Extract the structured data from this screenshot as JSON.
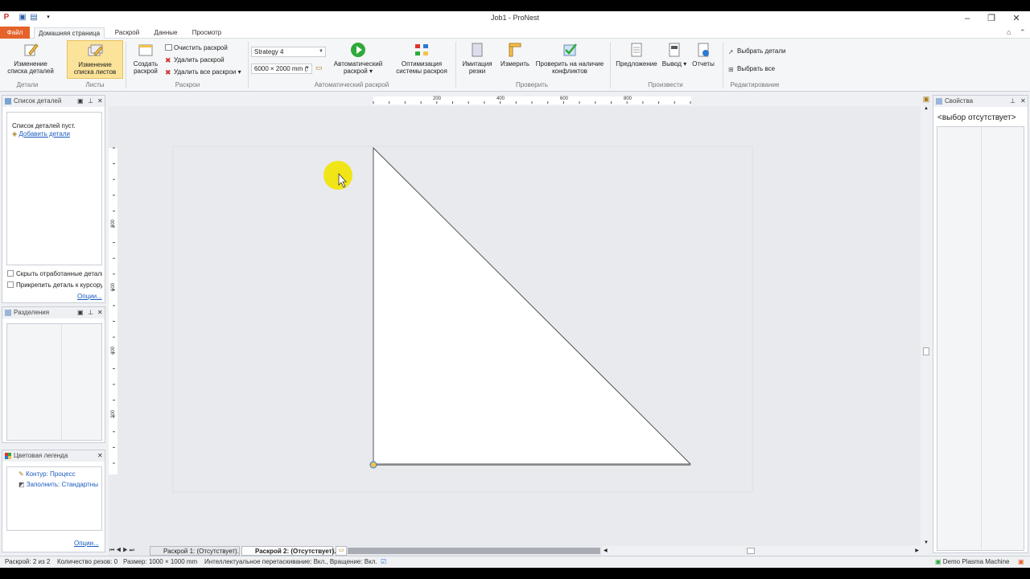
{
  "window": {
    "title": "Job1 - ProNest"
  },
  "ribbon_tabs": {
    "file": "Файл",
    "items": [
      "Домашняя страница",
      "Раскрой",
      "Данные",
      "Просмотр"
    ]
  },
  "ribbon": {
    "details": {
      "btn": "Изменение списка деталей",
      "group": "Детали"
    },
    "sheets": {
      "btn": "Изменение списка листов",
      "group": "Листы"
    },
    "nests": {
      "create": "Создать раскрой",
      "clear": "Очистить раскрой",
      "delete": "Удалить раскрой",
      "delete_all": "Удалить все раскрои",
      "group": "Раскрои"
    },
    "auto": {
      "strategy": "Strategy 4",
      "sheet_size": "6000 × 2000 mm (.",
      "btn": "Автоматический раскрой",
      "optimize": "Оптимизация системы раскроя",
      "group": "Автоматический раскрой"
    },
    "check": {
      "simulate": "Имитация резки",
      "measure": "Измерить",
      "conflicts": "Проверить на наличие конфликтов",
      "group": "Проверить"
    },
    "output": {
      "proposal": "Предложение",
      "output": "Вывод",
      "reports": "Отчеты",
      "group": "Произвести"
    },
    "edit": {
      "select_parts": "Выбрать детали",
      "select_all": "Выбрать все",
      "group": "Редактирование"
    }
  },
  "parts_panel": {
    "title": "Список деталей",
    "empty": "Список деталей пуст.",
    "add": "Добавить детали",
    "hide": "Скрыть отработанные детали",
    "attach": "Прикрепить деталь к курсору",
    "options": "Опции..."
  },
  "divisions_panel": {
    "title": "Разделения"
  },
  "legend_panel": {
    "title": "Цветовая легенда",
    "items": [
      "Контур: Процесс",
      "Заполнить: Стандартны"
    ],
    "options": "Опции..."
  },
  "properties_panel": {
    "title": "Свойства",
    "value": "<выбор отсутствует>"
  },
  "ruler": {
    "top_labels": [
      "200",
      "400",
      "600",
      "800"
    ],
    "left_labels": [
      "800",
      "600",
      "400",
      "200"
    ]
  },
  "sheet_tabs": [
    "Раскрой 1: (Отсутствует).",
    "Раскрой 2: (Отсутствует)."
  ],
  "status": {
    "nest": "Раскрой: 2 из 2",
    "cuts": "Количество резов: 0",
    "size": "Размер: 1000 × 1000 mm",
    "drag": "Интеллектуальное перетаскивание: Вкл., Вращение: Вкл.",
    "machine": "Demo Plasma Machine"
  },
  "colors": {
    "file_tab": "#e5632a",
    "link": "#1a5bbf",
    "cursor_highlight": "#f2e400"
  }
}
